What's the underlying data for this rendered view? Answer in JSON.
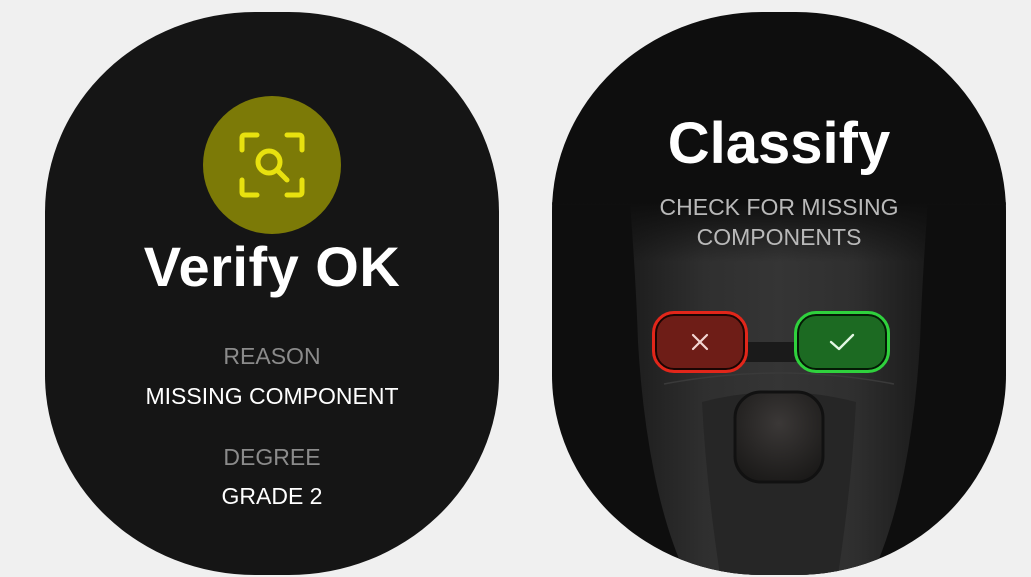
{
  "left_card": {
    "icon": "scan-search-icon",
    "title": "Verify OK",
    "reason_label": "REASON",
    "reason_value": "MISSING COMPONENT",
    "degree_label": "DEGREE",
    "degree_value": "GRADE 2"
  },
  "right_card": {
    "title": "Classify",
    "subtitle_line1": "CHECK FOR MISSING",
    "subtitle_line2": "COMPONENTS",
    "reject_icon": "close-icon",
    "accept_icon": "checkmark-icon"
  },
  "colors": {
    "card_bg": "#151515",
    "accent_yellow": "#e8e10f",
    "icon_circle": "#7c7a07",
    "reject_red": "#e2261a",
    "accept_green": "#2fd13d"
  }
}
